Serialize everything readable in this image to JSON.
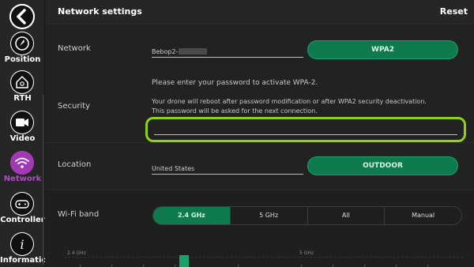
{
  "header": {
    "title": "Network settings",
    "reset_label": "Reset"
  },
  "sidebar": {
    "back_icon": "chevron-left-icon",
    "items": [
      {
        "label": "Position",
        "icon": "compass-icon",
        "active": false
      },
      {
        "label": "RTH",
        "icon": "home-icon",
        "active": false
      },
      {
        "label": "Video",
        "icon": "video-camera-icon",
        "active": false
      },
      {
        "label": "Network",
        "icon": "wifi-icon",
        "active": true
      },
      {
        "label": "Controller",
        "icon": "gamepad-icon",
        "active": false
      },
      {
        "label": "Information",
        "icon": "info-icon",
        "active": false
      }
    ]
  },
  "network": {
    "label": "Network",
    "name_value": "Bebop2-",
    "security_button": "WPA2"
  },
  "security": {
    "label": "Security",
    "prompt": "Please enter your password to activate WPA-2.",
    "info_line1": "Your drone will reboot after password modification or after WPA2 security deactivation.",
    "info_line2": "This password will be asked for the next connection.",
    "password_value": ""
  },
  "location": {
    "label": "Location",
    "country_value": "United States",
    "mode_button": "OUTDOOR"
  },
  "wifi_band": {
    "label": "Wi-Fi band",
    "options": [
      "2.4 GHz",
      "5 GHz",
      "All",
      "Manual"
    ],
    "selected": "2.4 GHz",
    "graph_label_24": "2.4 GHz",
    "graph_label_5": "5 GHz"
  },
  "colors": {
    "accent_green": "#0f7a4e",
    "highlight_lime": "#8fd119",
    "active_purple": "#a23bb3"
  }
}
